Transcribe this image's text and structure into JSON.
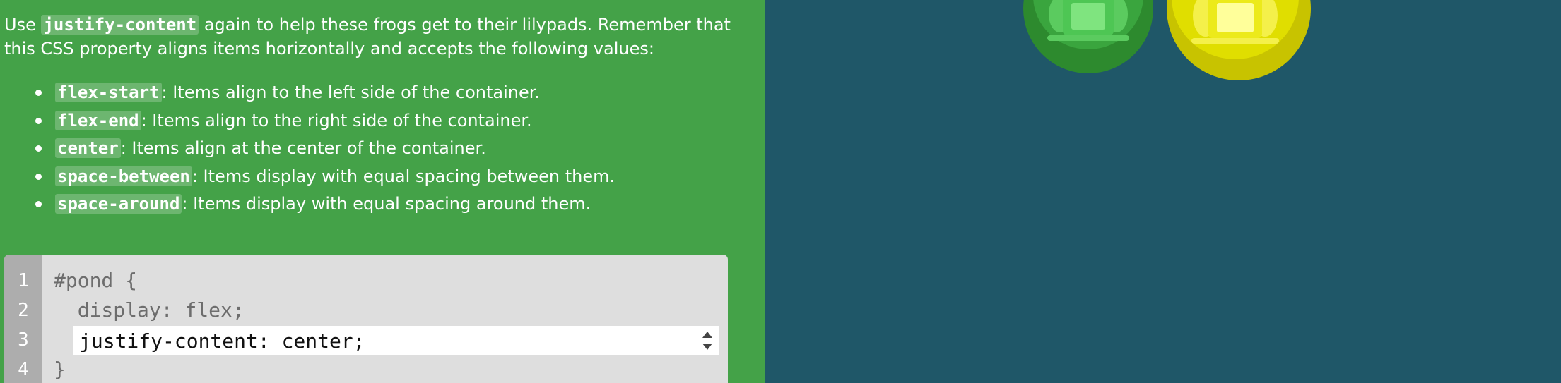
{
  "instructions": {
    "prefix": "Use ",
    "property": "justify-content",
    "suffix": " again to help these frogs get to their lilypads. Remember that this CSS property aligns items horizontally and accepts the following values:"
  },
  "values": [
    {
      "keyword": "flex-start",
      "description": ": Items align to the left side of the container."
    },
    {
      "keyword": "flex-end",
      "description": ": Items align to the right side of the container."
    },
    {
      "keyword": "center",
      "description": ": Items align at the center of the container."
    },
    {
      "keyword": "space-between",
      "description": ": Items display with equal spacing between them."
    },
    {
      "keyword": "space-around",
      "description": ": Items display with equal spacing around them."
    }
  ],
  "editor": {
    "line_numbers": [
      "1",
      "2",
      "3",
      "4"
    ],
    "line1": "#pond {",
    "line2": "  display: flex;",
    "input_value": "justify-content: center;",
    "line4": "}"
  },
  "board": {
    "lilypads": [
      {
        "color": "green",
        "hex": "#2d8a2e"
      },
      {
        "color": "yellow",
        "hex": "#c8c300"
      }
    ],
    "frogs": [
      {
        "color": "green",
        "hex": "#4ec654"
      },
      {
        "color": "yellow",
        "hex": "#ecea1a"
      }
    ]
  },
  "colors": {
    "sidebar_bg": "#44a248",
    "board_bg": "#1f5768",
    "editor_bg": "#dedede",
    "gutter_bg": "#adadad"
  }
}
